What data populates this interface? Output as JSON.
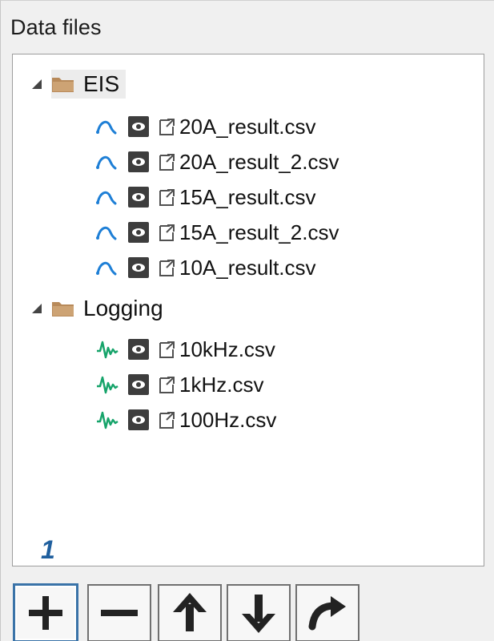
{
  "panel": {
    "title": "Data files"
  },
  "tree": {
    "groups": [
      {
        "label": "EIS",
        "files": [
          {
            "name": "20A_result.csv",
            "kind_icon": "arc-icon"
          },
          {
            "name": "20A_result_2.csv",
            "kind_icon": "arc-icon"
          },
          {
            "name": "15A_result.csv",
            "kind_icon": "arc-icon"
          },
          {
            "name": "15A_result_2.csv",
            "kind_icon": "arc-icon"
          },
          {
            "name": "10A_result.csv",
            "kind_icon": "arc-icon"
          }
        ]
      },
      {
        "label": "Logging",
        "files": [
          {
            "name": "10kHz.csv",
            "kind_icon": "waveform-icon"
          },
          {
            "name": "1kHz.csv",
            "kind_icon": "waveform-icon"
          },
          {
            "name": "100Hz.csv",
            "kind_icon": "waveform-icon"
          }
        ]
      }
    ]
  },
  "callout": {
    "number": "1"
  },
  "toolbar": {
    "buttons": [
      {
        "name": "add",
        "icon": "plus-icon"
      },
      {
        "name": "remove",
        "icon": "minus-icon"
      },
      {
        "name": "move-up",
        "icon": "arrow-up-icon"
      },
      {
        "name": "move-down",
        "icon": "arrow-down-icon"
      },
      {
        "name": "export",
        "icon": "arrow-right-icon"
      }
    ]
  },
  "colors": {
    "eis_curve": "#1e7fd6",
    "logging_wave": "#17a46b",
    "folder": "#b88a5a",
    "eye_bg": "#3d3d3d",
    "selection": "#ececec",
    "callout": "#1f5f9e"
  }
}
